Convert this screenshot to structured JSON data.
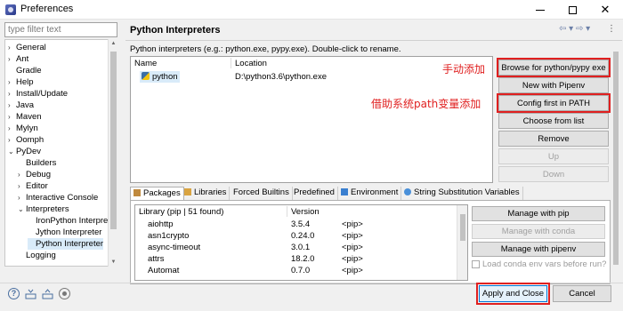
{
  "window": {
    "title": "Preferences",
    "close_glyph": "✕"
  },
  "filter": {
    "placeholder": "type filter text"
  },
  "tree": {
    "items": [
      {
        "label": "General",
        "expanded": false,
        "level": 0
      },
      {
        "label": "Ant",
        "expanded": false,
        "level": 0
      },
      {
        "label": "Gradle",
        "expanded": null,
        "level": 0
      },
      {
        "label": "Help",
        "expanded": false,
        "level": 0
      },
      {
        "label": "Install/Update",
        "expanded": false,
        "level": 0
      },
      {
        "label": "Java",
        "expanded": false,
        "level": 0
      },
      {
        "label": "Maven",
        "expanded": false,
        "level": 0
      },
      {
        "label": "Mylyn",
        "expanded": false,
        "level": 0
      },
      {
        "label": "Oomph",
        "expanded": false,
        "level": 0
      },
      {
        "label": "PyDev",
        "expanded": true,
        "level": 0
      },
      {
        "label": "Builders",
        "expanded": null,
        "level": 1
      },
      {
        "label": "Debug",
        "expanded": false,
        "level": 1
      },
      {
        "label": "Editor",
        "expanded": false,
        "level": 1
      },
      {
        "label": "Interactive Console",
        "expanded": false,
        "level": 1
      },
      {
        "label": "Interpreters",
        "expanded": true,
        "level": 1
      },
      {
        "label": "IronPython Interpre",
        "expanded": null,
        "level": 2
      },
      {
        "label": "Jython Interpreter",
        "expanded": null,
        "level": 2
      },
      {
        "label": "Python Interpreter",
        "expanded": null,
        "level": 2,
        "selected": true
      },
      {
        "label": "Logging",
        "expanded": null,
        "level": 1
      }
    ]
  },
  "header": {
    "title": "Python Interpreters",
    "nav_arrows": "⇦ ▾ ⇨ ▾",
    "menu_glyph": "⋮"
  },
  "description": "Python interpreters (e.g.: python.exe, pypy.exe).   Double-click to rename.",
  "interpreters": {
    "columns": [
      "Name",
      "Location"
    ],
    "rows": [
      {
        "name": "python",
        "location": "D:\\python3.6\\python.exe"
      }
    ]
  },
  "annotations": {
    "manual": "手动添加",
    "path": "借助系统path变量添加"
  },
  "buttons": {
    "browse": "Browse for python/pypy exe",
    "pipenv": "New with Pipenv",
    "config": "Config first in PATH",
    "choose": "Choose from list",
    "remove": "Remove",
    "up": "Up",
    "down": "Down"
  },
  "tabs": [
    "Packages",
    "Libraries",
    "Forced Builtins",
    "Predefined",
    "Environment",
    "String Substitution Variables"
  ],
  "library": {
    "columns": [
      "Library (pip | 51 found)",
      "Version",
      ""
    ],
    "rows": [
      {
        "name": "aiohttp",
        "version": "3.5.4",
        "source": "<pip>"
      },
      {
        "name": "asn1crypto",
        "version": "0.24.0",
        "source": "<pip>"
      },
      {
        "name": "async-timeout",
        "version": "3.0.1",
        "source": "<pip>"
      },
      {
        "name": "attrs",
        "version": "18.2.0",
        "source": "<pip>"
      },
      {
        "name": "Automat",
        "version": "0.7.0",
        "source": "<pip>"
      }
    ]
  },
  "library_buttons": {
    "pip": "Manage with pip",
    "conda": "Manage with conda",
    "pipenv": "Manage with pipenv",
    "conda_check": "Load conda env vars before run?"
  },
  "footer": {
    "apply_close": "Apply and Close",
    "cancel": "Cancel",
    "help_glyph": "?"
  },
  "colors": {
    "annotation": "#e02020",
    "selection": "#d9ebf9",
    "accent": "#0078d7"
  }
}
